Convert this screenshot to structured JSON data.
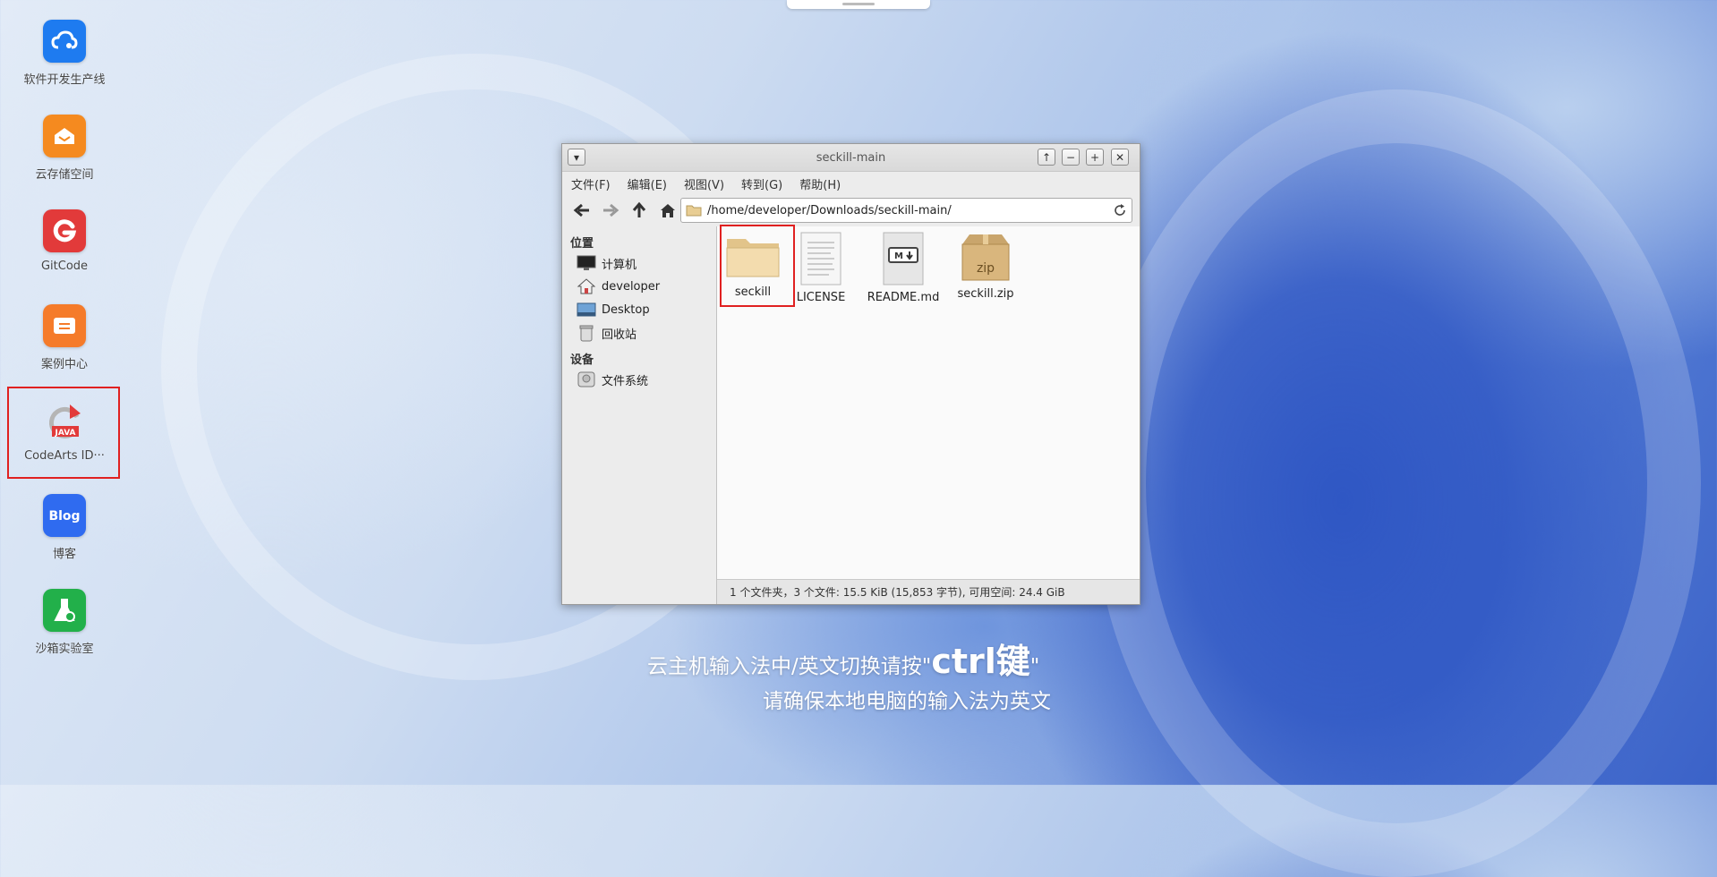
{
  "desktop": {
    "icons": [
      {
        "label": "软件开发生产线",
        "icon": "cloud-pipeline-icon",
        "color": "#1e7bf0"
      },
      {
        "label": "云存储空间",
        "icon": "cloud-storage-icon",
        "color": "#f58a1f"
      },
      {
        "label": "GitCode",
        "icon": "gitcode-icon",
        "color": "#e23a3a"
      },
      {
        "label": "案例中心",
        "icon": "case-center-icon",
        "color": "#f57b2a"
      },
      {
        "label": "CodeArts ID···",
        "icon": "codearts-java-icon",
        "color": "#e23a3a"
      },
      {
        "label": "博客",
        "icon": "blog-icon",
        "color": "#2f6bf0"
      },
      {
        "label": "沙箱实验室",
        "icon": "sandbox-lab-icon",
        "color": "#22b04a"
      }
    ],
    "hint_line1_prefix": "云主机输入法中/英文切换请按\"",
    "hint_line1_key": "ctrl键",
    "hint_line1_suffix": "\"",
    "hint_line2": "请确保本地电脑的输入法为英文"
  },
  "window": {
    "title": "seckill-main",
    "menu": [
      "文件(F)",
      "编辑(E)",
      "视图(V)",
      "转到(G)",
      "帮助(H)"
    ],
    "address": "/home/developer/Downloads/seckill-main/",
    "sidebar": {
      "places_header": "位置",
      "places": [
        "计算机",
        "developer",
        "Desktop",
        "回收站"
      ],
      "devices_header": "设备",
      "devices": [
        "文件系统"
      ]
    },
    "files": [
      {
        "name": "seckill",
        "type": "folder"
      },
      {
        "name": "LICENSE",
        "type": "text"
      },
      {
        "name": "README.md",
        "type": "markdown"
      },
      {
        "name": "seckill.zip",
        "type": "zip"
      }
    ],
    "status": "1 个文件夹，3 个文件: 15.5 KiB (15,853 字节), 可用空间: 24.4 GiB"
  },
  "colors": {
    "highlight_box": "#e02020",
    "accent_blue": "#2f57c4"
  }
}
